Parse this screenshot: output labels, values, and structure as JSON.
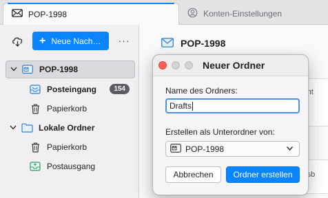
{
  "tabs": [
    {
      "label": "POP-1998",
      "icon": "envelope-icon"
    },
    {
      "label": "Konten-Einstellungen",
      "icon": "settings-icon"
    }
  ],
  "toolbar": {
    "new_message_label": "Neue Nach…"
  },
  "folders": {
    "account_name": "POP-1998",
    "inbox": {
      "label": "Posteingang",
      "count": "154"
    },
    "trash": {
      "label": "Papierkorb"
    },
    "local": {
      "label": "Lokale Ordner"
    },
    "local_trash": {
      "label": "Papierkorb"
    },
    "outbox": {
      "label": "Postausgang"
    }
  },
  "main": {
    "header_title": "POP-1998",
    "peek_text_1": "richt",
    "peek_text_2": "essb"
  },
  "dialog": {
    "title": "Neuer Ordner",
    "name_label": "Name des Ordners:",
    "name_value": "Drafts",
    "parent_label": "Erstellen als Unterordner von:",
    "parent_value": "POP-1998",
    "cancel_label": "Abbrechen",
    "create_label": "Ordner erstellen"
  },
  "colors": {
    "accent": "#0a84ff",
    "close_light": "#fe5f57"
  }
}
